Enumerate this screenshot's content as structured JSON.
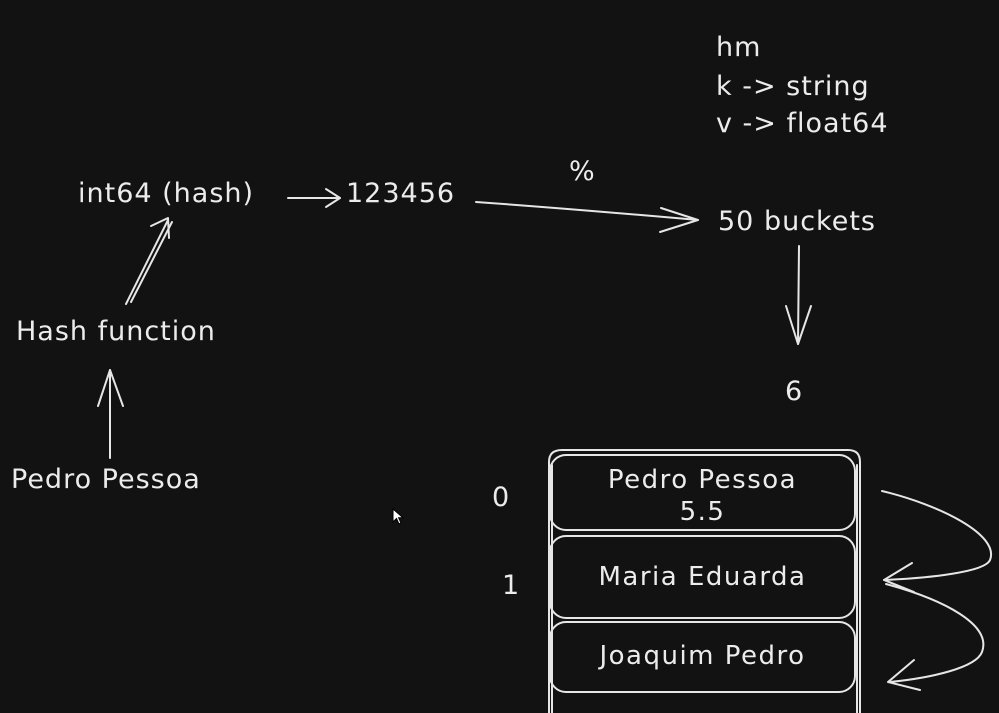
{
  "notes": {
    "line1": "hm",
    "line2": "k -> string",
    "line3": "v -> float64"
  },
  "flow": {
    "hash_type": "int64 (hash)",
    "hash_value": "123456",
    "modulo_symbol": "%",
    "buckets": "50 buckets",
    "bucket_index": "6",
    "hash_function": "Hash function",
    "input_key": "Pedro Pessoa"
  },
  "bucket_list": {
    "indices": [
      "0",
      "1"
    ],
    "entries": [
      {
        "name": "Pedro Pessoa",
        "value": "5.5"
      },
      {
        "name": "Maria Eduarda"
      },
      {
        "name": "Joaquim Pedro"
      }
    ]
  },
  "colors": {
    "background": "#121212",
    "ink": "#e8e8e8"
  }
}
